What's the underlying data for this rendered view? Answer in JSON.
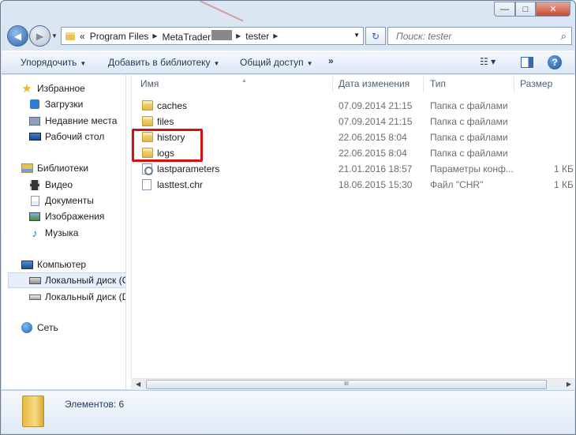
{
  "address": {
    "back_glyph": "◀",
    "forward_glyph": "▶",
    "overflow_glyph": "«",
    "segments": [
      "Program Files",
      "MetaTrader",
      "tester"
    ],
    "refresh_glyph": "↻"
  },
  "search": {
    "placeholder": "Поиск: tester",
    "icon": "magnifier-icon"
  },
  "caption": {
    "minimize": "—",
    "maximize": "□",
    "close": "✕"
  },
  "toolbar": {
    "organize": "Упорядочить",
    "add_to_library": "Добавить в библиотеку",
    "share": "Общий доступ",
    "more": "»",
    "view_glyph": "☷ ▾",
    "help": "?"
  },
  "nav": {
    "favorites": "Избранное",
    "downloads": "Загрузки",
    "recent": "Недавние места",
    "desktop": "Рабочий стол",
    "libraries": "Библиотеки",
    "video": "Видео",
    "documents": "Документы",
    "images": "Изображения",
    "music": "Музыка",
    "computer": "Компьютер",
    "disk_c": "Локальный диск (C",
    "disk_d": "Локальный диск (D",
    "network": "Сеть"
  },
  "columns": {
    "name": "Имя",
    "date": "Дата изменения",
    "type": "Тип",
    "size": "Размер"
  },
  "files": [
    {
      "name": "caches",
      "date": "07.09.2014 21:15",
      "type": "Папка с файлами",
      "size": ""
    },
    {
      "name": "files",
      "date": "07.09.2014 21:15",
      "type": "Папка с файлами",
      "size": ""
    },
    {
      "name": "history",
      "date": "22.06.2015 8:04",
      "type": "Папка с файлами",
      "size": ""
    },
    {
      "name": "logs",
      "date": "22.06.2015 8:04",
      "type": "Папка с файлами",
      "size": ""
    },
    {
      "name": "lastparameters",
      "date": "21.01.2016 18:57",
      "type": "Параметры конф...",
      "size": "1 КБ"
    },
    {
      "name": "lasttest.chr",
      "date": "18.06.2015 15:30",
      "type": "Файл \"CHR\"",
      "size": "1 КБ"
    }
  ],
  "scrollbar": {
    "left": "◀",
    "right": "▶",
    "grip": "III"
  },
  "details": {
    "item_count": "Элементов: 6"
  },
  "colors": {
    "highlight": "#d41010",
    "accent": "#1e395b"
  }
}
